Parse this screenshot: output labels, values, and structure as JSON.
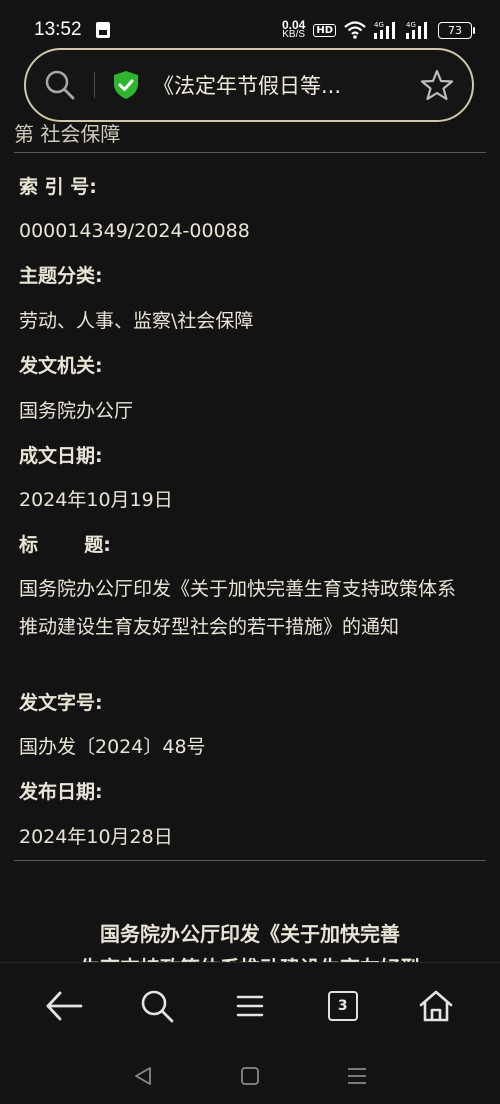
{
  "status": {
    "time": "13:52",
    "net_speed_value": "0.04",
    "net_speed_unit": "KB/S",
    "hd": "HD",
    "sig1": "4G",
    "sig2": "4G",
    "battery": "73"
  },
  "address": {
    "title": "《法定年节假日等..."
  },
  "page": {
    "top_cut": "第  社会保障",
    "fields": [
      {
        "label": "索 引 号:",
        "value": "000014349/2024-00088"
      },
      {
        "label": "主题分类:",
        "value": "劳动、人事、监察\\社会保障"
      },
      {
        "label": "发文机关:",
        "value": "国务院办公厅"
      },
      {
        "label": "成文日期:",
        "value": "2024年10月19日"
      },
      {
        "label": "标       题:",
        "value": "国务院办公厅印发《关于加快完善生育支持政策体系推动建设生育友好型社会的若干措施》的通知"
      },
      {
        "label": "发文字号:",
        "value": "国办发〔2024〕48号"
      },
      {
        "label": "发布日期:",
        "value": "2024年10月28日"
      }
    ],
    "article_heading_line1": "国务院办公厅印发《关于加快完善",
    "article_heading_line2": "生育支持政策体系推动建设生育友好型"
  },
  "toolbar": {
    "tabs_count": "3"
  }
}
